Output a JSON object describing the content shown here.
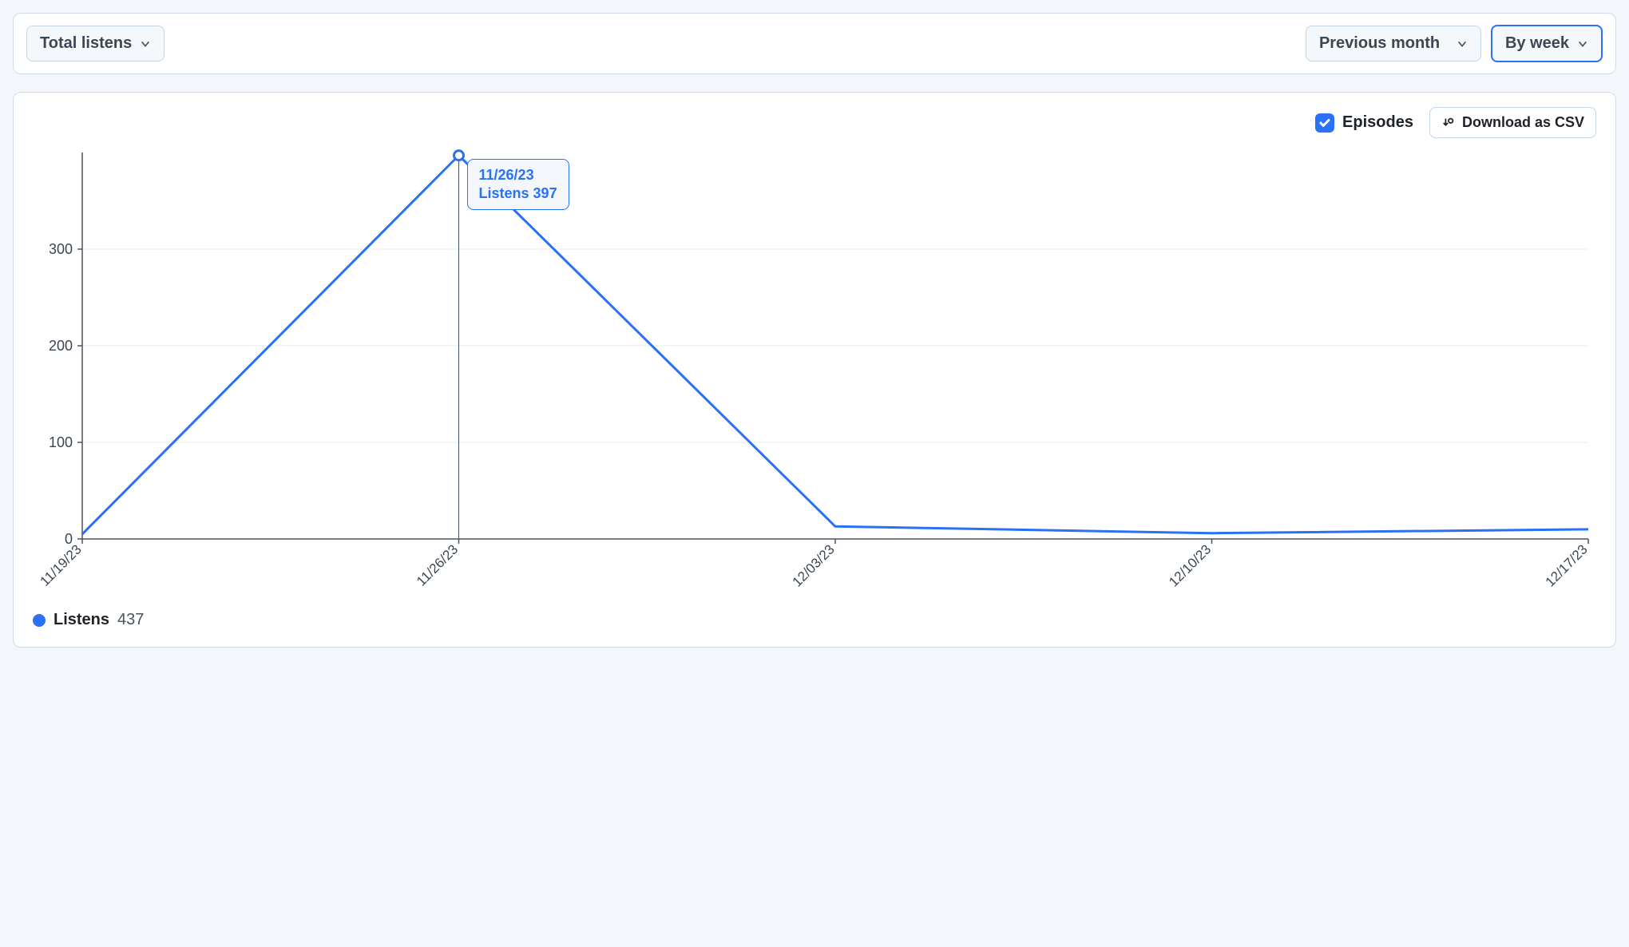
{
  "toolbar": {
    "metric_select": "Total listens",
    "range_select": "Previous month",
    "granularity_select": "By week"
  },
  "header": {
    "episodes_label": "Episodes",
    "episodes_checked": true,
    "download_label": "Download as CSV"
  },
  "tooltip": {
    "date": "11/26/23",
    "label": "Listens",
    "value": 397
  },
  "legend": {
    "series_label": "Listens",
    "total": 437
  },
  "chart_data": {
    "type": "line",
    "categories": [
      "11/19/23",
      "11/26/23",
      "12/03/23",
      "12/10/23",
      "12/17/23"
    ],
    "series": [
      {
        "name": "Listens",
        "values": [
          5,
          397,
          13,
          6,
          10
        ]
      }
    ],
    "ylim": [
      0,
      400
    ],
    "yticks": [
      0,
      100,
      200,
      300
    ],
    "hover_index": 1,
    "xlabel": "",
    "ylabel": ""
  },
  "colors": {
    "accent": "#2a71f6",
    "grid": "#e7edf3",
    "axis": "#3d4652",
    "axis_line": "#4a5360"
  }
}
